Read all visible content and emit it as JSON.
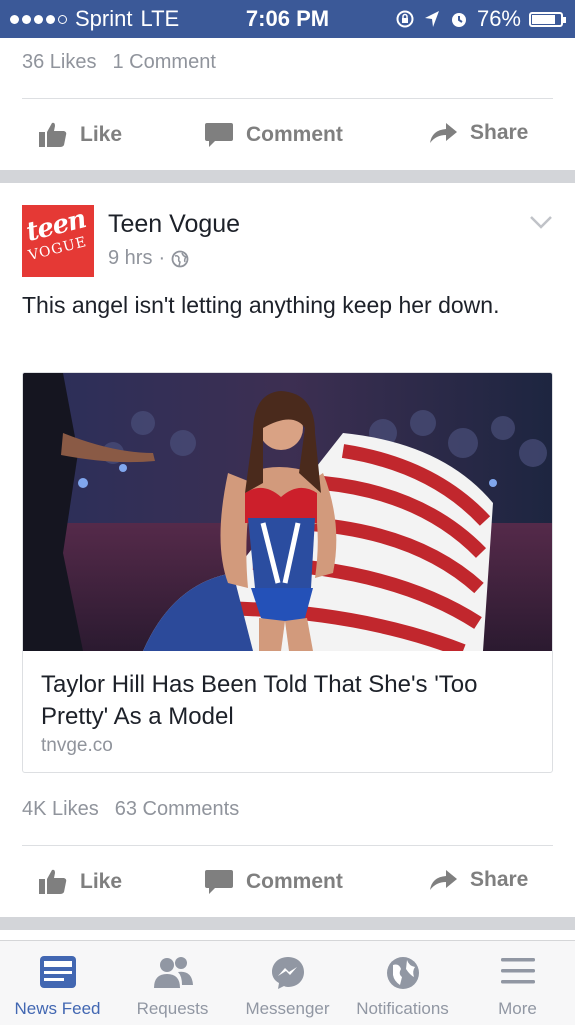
{
  "status_bar": {
    "carrier": "Sprint",
    "network": "LTE",
    "time": "7:06 PM",
    "battery": "76%",
    "battery_level": 0.76,
    "icons": [
      "lock-rotation-icon",
      "location-arrow-icon",
      "alarm-icon",
      "battery-icon"
    ]
  },
  "prev_post": {
    "likes": "36 Likes",
    "comments": "1 Comment"
  },
  "actions": {
    "like": "Like",
    "comment": "Comment",
    "share": "Share"
  },
  "post": {
    "author": "Teen Vogue",
    "logo_text_top": "teen",
    "logo_text_bottom": "VOGUE",
    "time": "9 hrs",
    "separator": "·",
    "text": "This angel isn't letting anything keep her down.",
    "link": {
      "title": "Taylor Hill Has Been Told That She's 'Too Pretty' As a Model",
      "domain": "tnvge.co"
    },
    "likes": "4K Likes",
    "comments": "63 Comments"
  },
  "tabbar": {
    "items": [
      {
        "label": "News Feed",
        "icon": "news-feed-icon",
        "active": true
      },
      {
        "label": "Requests",
        "icon": "friends-icon",
        "active": false
      },
      {
        "label": "Messenger",
        "icon": "messenger-icon",
        "active": false
      },
      {
        "label": "Notifications",
        "icon": "globe-icon",
        "active": false
      },
      {
        "label": "More",
        "icon": "menu-icon",
        "active": false
      }
    ]
  },
  "colors": {
    "brand": "#3b5998",
    "active_tab": "#4267b2",
    "logo_red": "#e53935"
  }
}
